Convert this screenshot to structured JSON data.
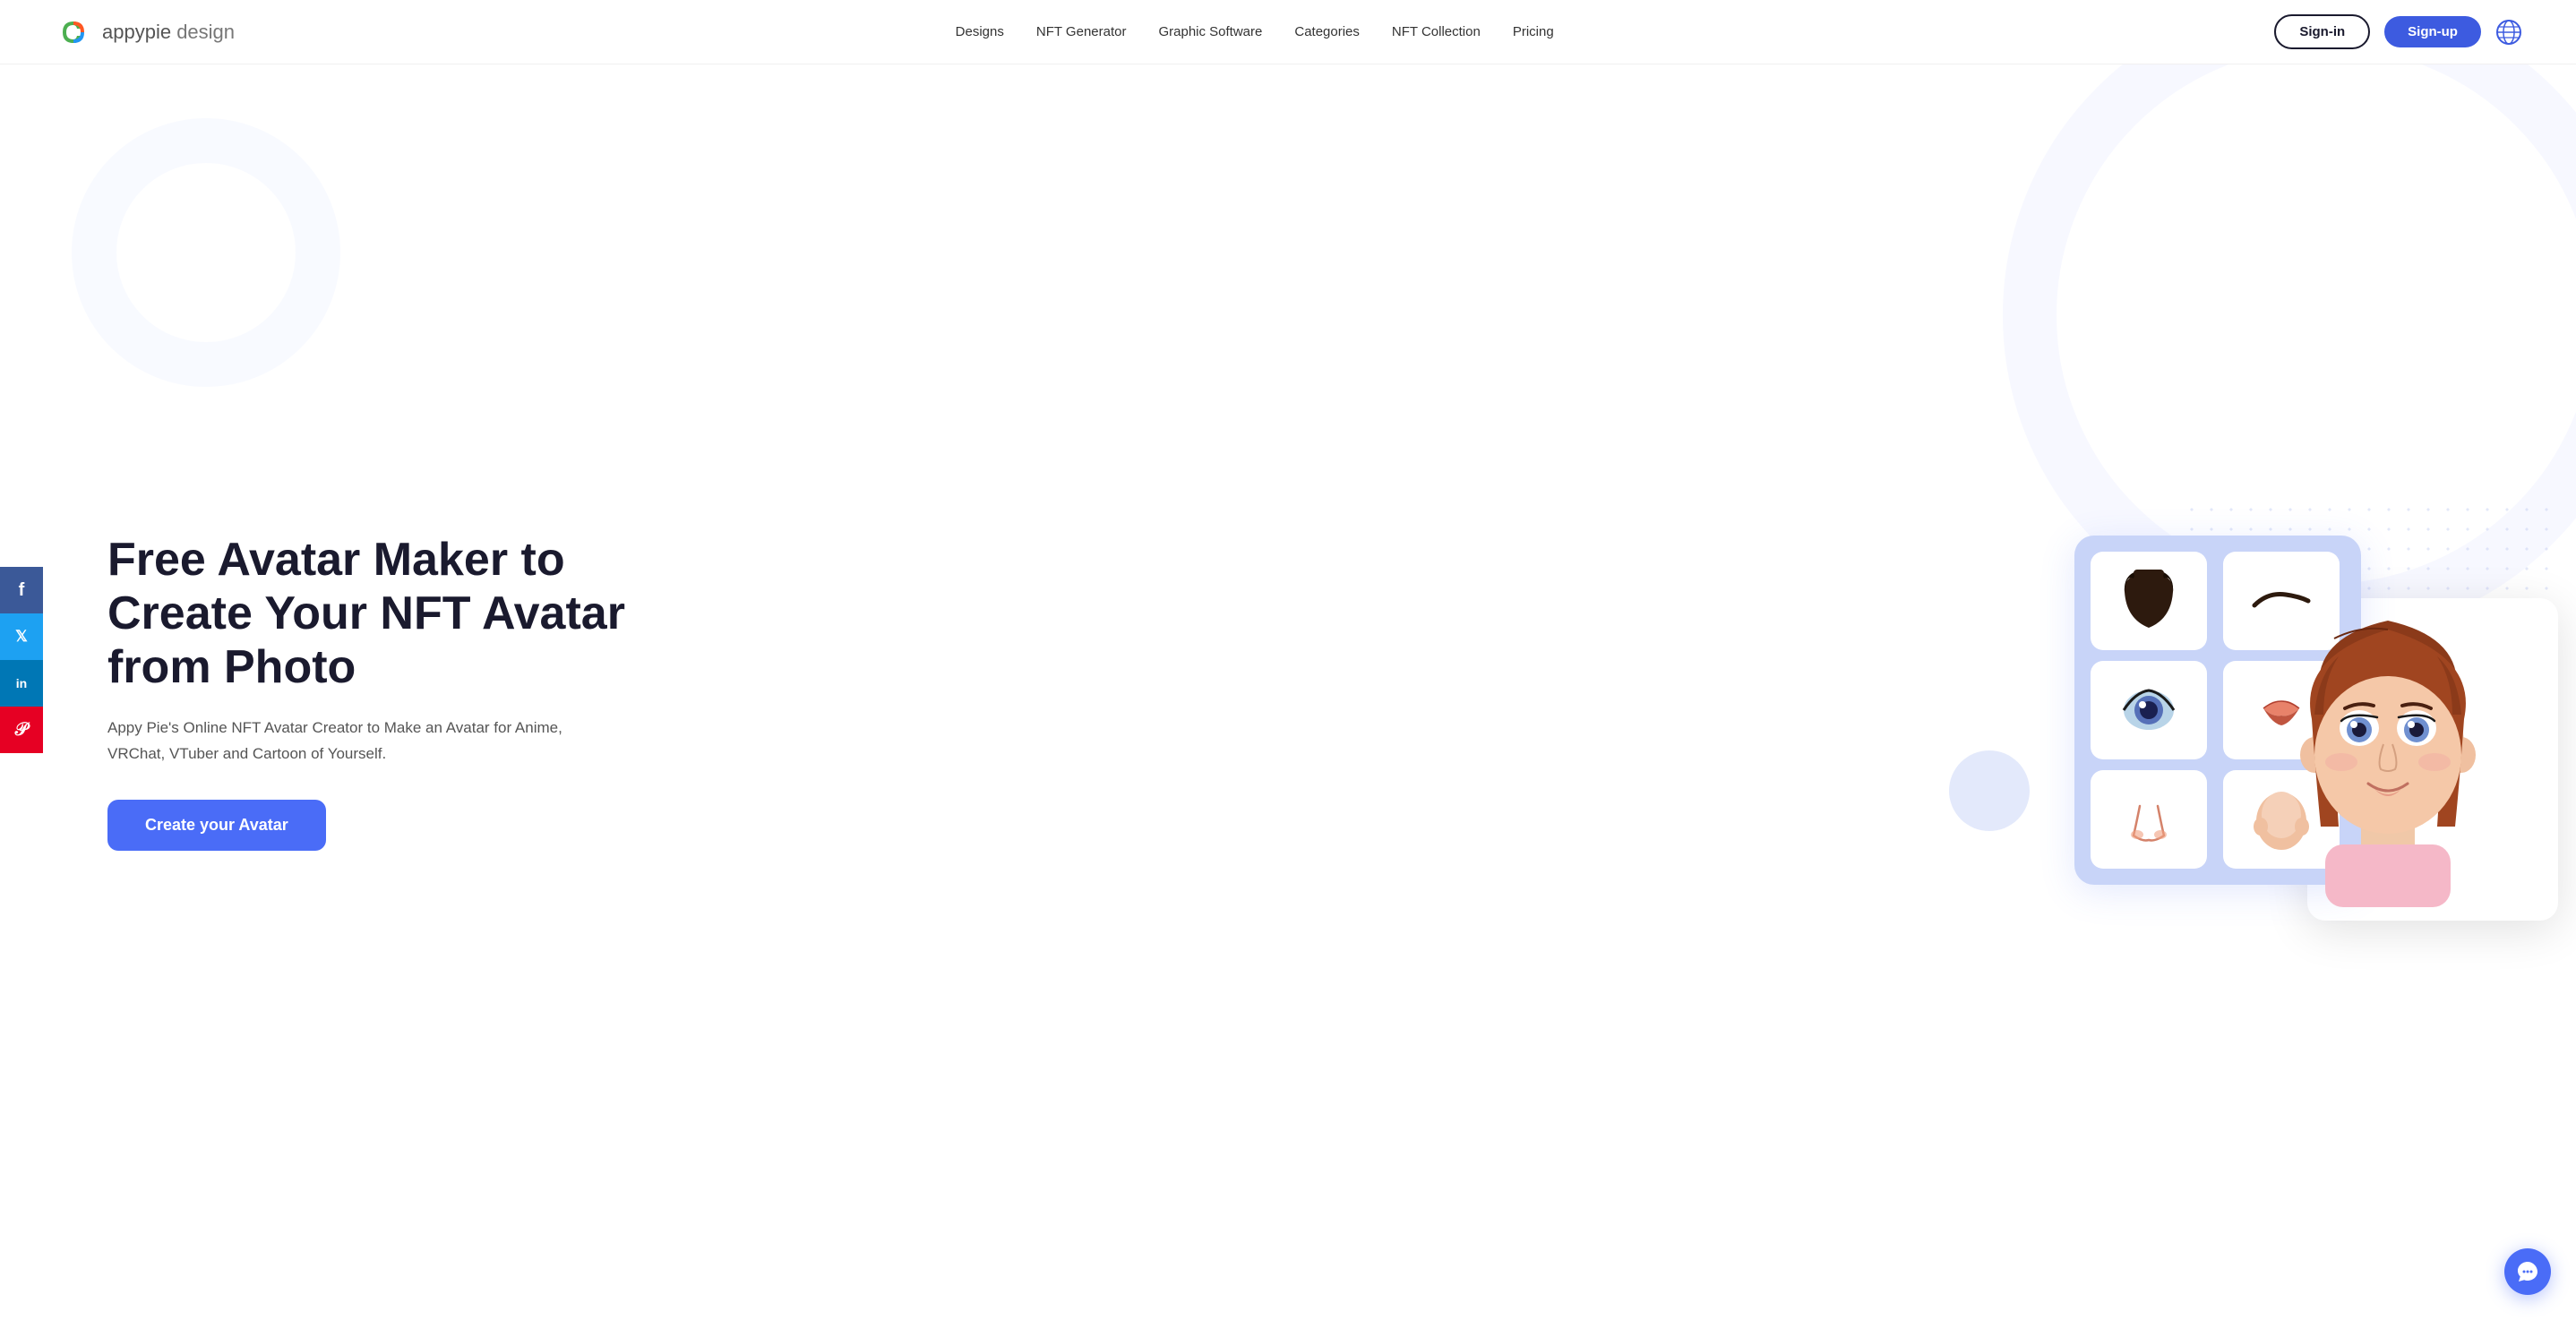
{
  "nav": {
    "logo_text": "appypie",
    "logo_sub": " design",
    "links": [
      {
        "label": "Designs",
        "id": "designs"
      },
      {
        "label": "NFT Generator",
        "id": "nft-generator"
      },
      {
        "label": "Graphic Software",
        "id": "graphic-software"
      },
      {
        "label": "Categories",
        "id": "categories"
      },
      {
        "label": "NFT Collection",
        "id": "nft-collection"
      },
      {
        "label": "Pricing",
        "id": "pricing"
      }
    ],
    "signin_label": "Sign-in",
    "signup_label": "Sign-up"
  },
  "social": [
    {
      "label": "f",
      "platform": "facebook",
      "class": "fb"
    },
    {
      "label": "t",
      "platform": "twitter",
      "class": "tw"
    },
    {
      "label": "in",
      "platform": "linkedin",
      "class": "li"
    },
    {
      "label": "p",
      "platform": "pinterest",
      "class": "pi"
    }
  ],
  "hero": {
    "title": "Free Avatar Maker to Create Your NFT Avatar from Photo",
    "subtitle": "Appy Pie's Online NFT Avatar Creator to Make an Avatar for Anime, VRChat, VTuber and Cartoon of Yourself.",
    "cta_label": "Create your Avatar"
  },
  "chat": {
    "tooltip": "Chat support"
  }
}
